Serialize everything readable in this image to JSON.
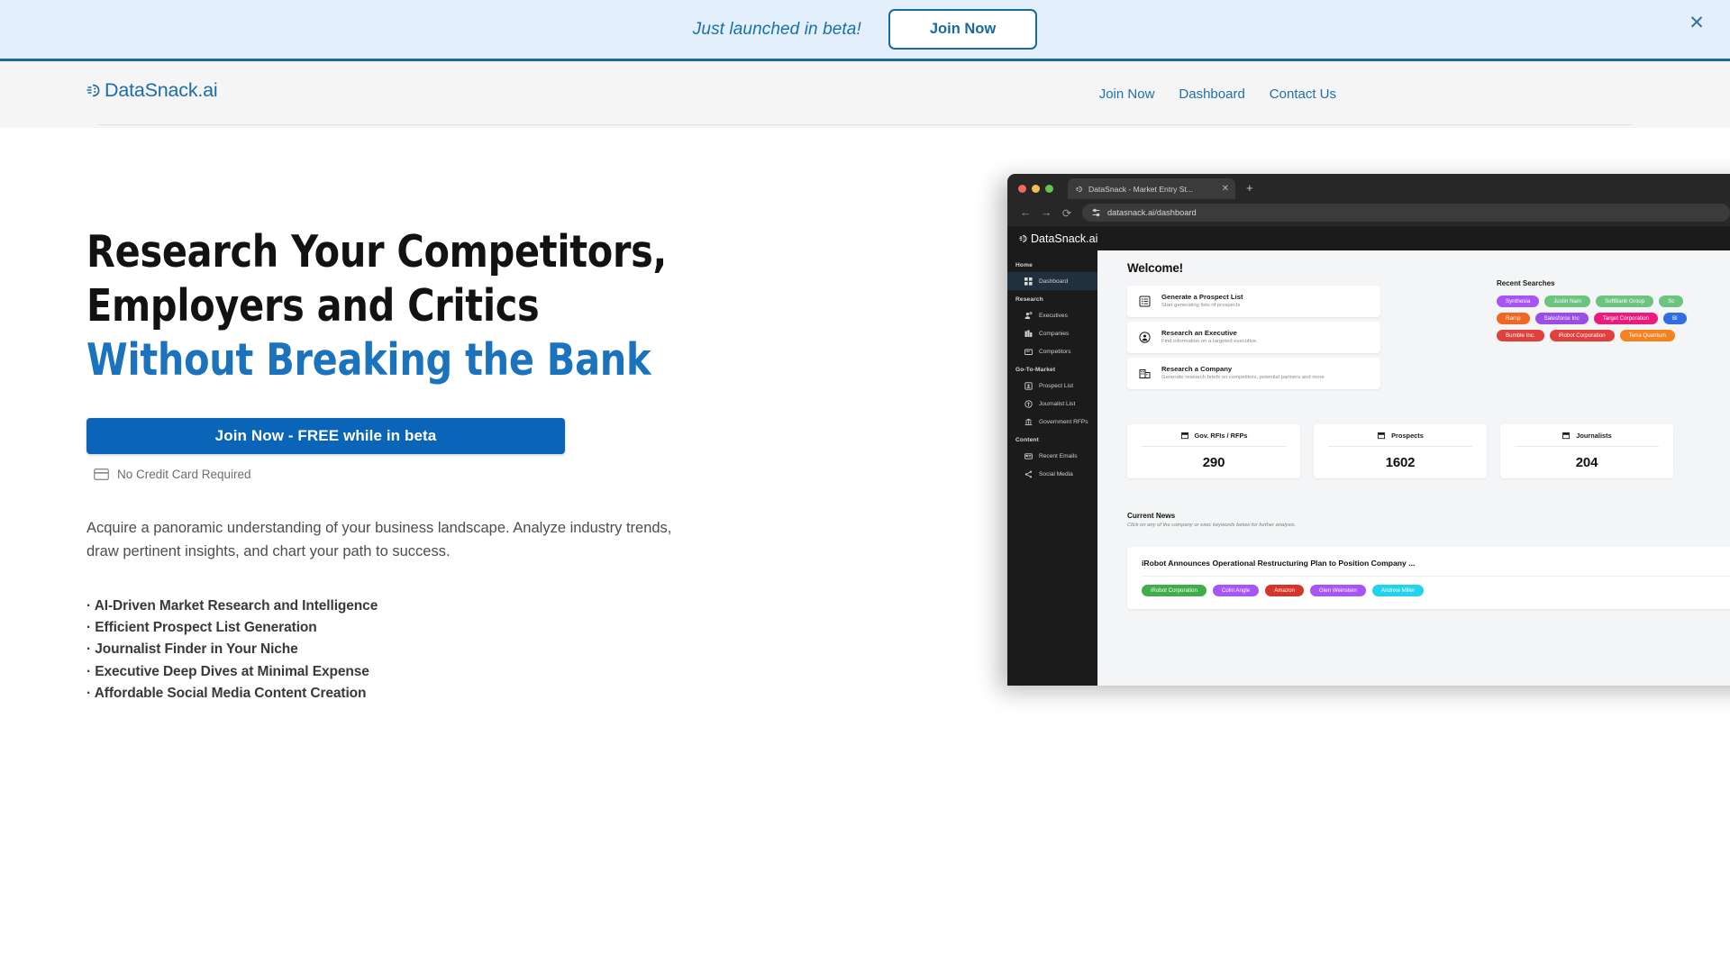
{
  "banner": {
    "message": "Just launched in beta!",
    "join_label": "Join Now",
    "close_icon": "close-icon"
  },
  "header": {
    "logo_text": "DataSnack.ai",
    "nav": [
      {
        "label": "Join Now"
      },
      {
        "label": "Dashboard"
      },
      {
        "label": "Contact Us"
      }
    ]
  },
  "hero": {
    "heading_line1": "Research Your Competitors, Employers",
    "heading_line2": "and Critics",
    "heading_accent": "Without Breaking the Bank",
    "cta_label": "Join Now - FREE while in beta",
    "no_credit_card": "No Credit Card Required",
    "paragraph": "Acquire a panoramic understanding of your business landscape. Analyze industry trends, draw pertinent insights, and chart your path to success.",
    "bullets": [
      "· AI-Driven Market Research and Intelligence",
      "· Efficient Prospect List Generation",
      "· Journalist Finder in Your Niche",
      "· Executive Deep Dives at Minimal Expense",
      "· Affordable Social Media Content Creation"
    ]
  },
  "browser": {
    "tab_title": "DataSnack - Market Entry St...",
    "new_tab_label": "+",
    "url": "datasnack.ai/dashboard",
    "back_icon": "←",
    "forward_icon": "→",
    "reload_icon": "⟳"
  },
  "app": {
    "logo_text": "DataSnack.ai",
    "sidebar": [
      {
        "type": "group",
        "label": "Home"
      },
      {
        "type": "item",
        "label": "Dashboard",
        "icon": "grid-icon",
        "active": true
      },
      {
        "type": "group",
        "label": "Research"
      },
      {
        "type": "item",
        "label": "Executives",
        "icon": "user-search-icon",
        "active": false
      },
      {
        "type": "item",
        "label": "Companies",
        "icon": "building-icon",
        "active": false
      },
      {
        "type": "item",
        "label": "Competitors",
        "icon": "folder-icon",
        "active": false
      },
      {
        "type": "group",
        "label": "Go-To-Market"
      },
      {
        "type": "item",
        "label": "Prospect List",
        "icon": "contact-card-icon",
        "active": false
      },
      {
        "type": "item",
        "label": "Journalist List",
        "icon": "info-circle-icon",
        "active": false
      },
      {
        "type": "item",
        "label": "Government RFPs",
        "icon": "bank-icon",
        "active": false
      },
      {
        "type": "group",
        "label": "Content"
      },
      {
        "type": "item",
        "label": "Recent Emails",
        "icon": "mail-card-icon",
        "active": false
      },
      {
        "type": "item",
        "label": "Social Media",
        "icon": "share-icon",
        "active": false
      }
    ],
    "welcome": "Welcome!",
    "quick_cards": [
      {
        "title": "Generate a Prospect List",
        "subtitle": "Start generating lists of prospects",
        "icon": "list-icon"
      },
      {
        "title": "Research an Executive",
        "subtitle": "Find information on a targeted executive.",
        "icon": "person-circle-icon"
      },
      {
        "title": "Research a Company",
        "subtitle": "Generate research briefs on competitors, potential partners and more",
        "icon": "company-icon"
      }
    ],
    "recent_searches_title": "Recent Searches",
    "recent_searches": [
      [
        {
          "label": "Synthesia",
          "color": "#a855f7"
        },
        {
          "label": "Justin Nam",
          "color": "#6dc47f"
        },
        {
          "label": "SoftBank Group",
          "color": "#6dc47f"
        },
        {
          "label": "Sc",
          "color": "#6dc47f"
        }
      ],
      [
        {
          "label": "Ramp",
          "color": "#f26522"
        },
        {
          "label": "Salesforce Inc",
          "color": "#9b4dea"
        },
        {
          "label": "Target Corporation",
          "color": "#ec1a7e"
        },
        {
          "label": "Bl",
          "color": "#2f6fe0"
        }
      ],
      [
        {
          "label": "Bumble Inc.",
          "color": "#e0413c"
        },
        {
          "label": "iRobot Corporation",
          "color": "#e0413c"
        },
        {
          "label": "Terra Quantum",
          "color": "#f58220"
        }
      ]
    ],
    "stats": [
      {
        "label": "Gov. RFIs / RFPs",
        "value": "290",
        "icon": "store-icon"
      },
      {
        "label": "Prospects",
        "value": "1602",
        "icon": "store-icon"
      },
      {
        "label": "Journalists",
        "value": "204",
        "icon": "store-icon"
      }
    ],
    "news_title": "Current News",
    "news_subtitle": "Click on any of the company or exec keywords below for further analysis.",
    "news_headline": "iRobot Announces Operational Restructuring Plan to Position Company ...",
    "news_tags": [
      {
        "label": "iRobot Corporation",
        "color": "#3fae4a"
      },
      {
        "label": "Colin Angle",
        "color": "#a855f7"
      },
      {
        "label": "Amazon",
        "color": "#d6352b"
      },
      {
        "label": "Glen Weinstein",
        "color": "#a855f7"
      },
      {
        "label": "Andrew Miller",
        "color": "#22d3ee"
      }
    ]
  },
  "colors": {
    "brand_blue": "#1b6cab",
    "cta_blue": "#0a64b8",
    "banner_bg": "#e3effa",
    "banner_border": "#17699e"
  }
}
